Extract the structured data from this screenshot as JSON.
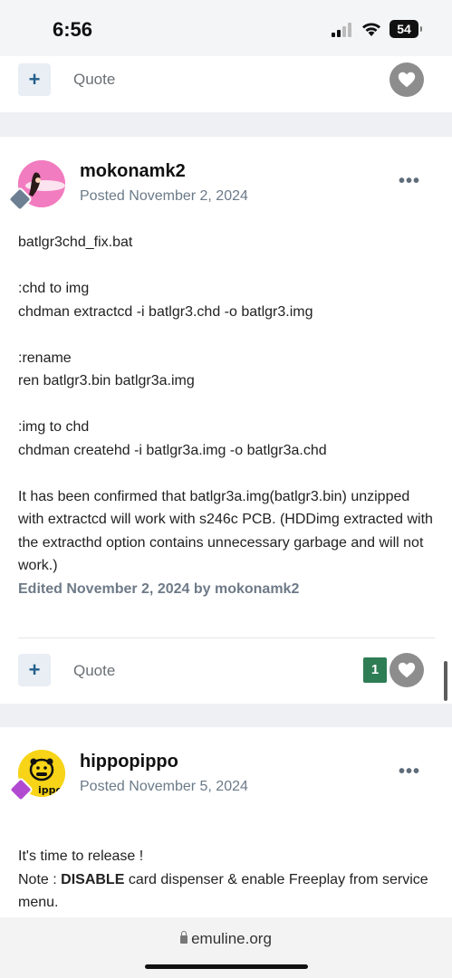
{
  "status_bar": {
    "time": "6:56",
    "battery": "54"
  },
  "top_card": {
    "quote_label": "Quote"
  },
  "post1": {
    "author": "mokonamk2",
    "posted": "Posted November 2, 2024",
    "more_label": "•••",
    "body_blocks": [
      "batlgr3chd_fix.bat",
      ":chd to img\nchdman extractcd -i batlgr3.chd -o batlgr3.img",
      ":rename\nren batlgr3.bin batlgr3a.img",
      ":img to chd\nchdman createhd -i batlgr3a.img -o batlgr3a.chd",
      "It has been confirmed that batlgr3a.img(batlgr3.bin) unzipped with extractcd will work with s246c PCB. (HDDimg extracted with the extracthd option contains unnecessary garbage and will not work.)"
    ],
    "edited": "Edited November 2, 2024 by mokonamk2",
    "quote_label": "Quote",
    "like_count": "1"
  },
  "post2": {
    "author": "hippopippo",
    "posted": "Posted November 5, 2024",
    "more_label": "•••",
    "avatar_text": "ippo",
    "body_line1": "It's time to release !",
    "note_prefix": "Note : ",
    "note_bold": "DISABLE",
    "note_rest": " card dispenser & enable Freeplay from service menu."
  },
  "url_bar": {
    "domain": "emuline.org"
  },
  "colors": {
    "accent": "#235f8a",
    "like_green": "#2e7d55",
    "background": "#eef0f3"
  }
}
